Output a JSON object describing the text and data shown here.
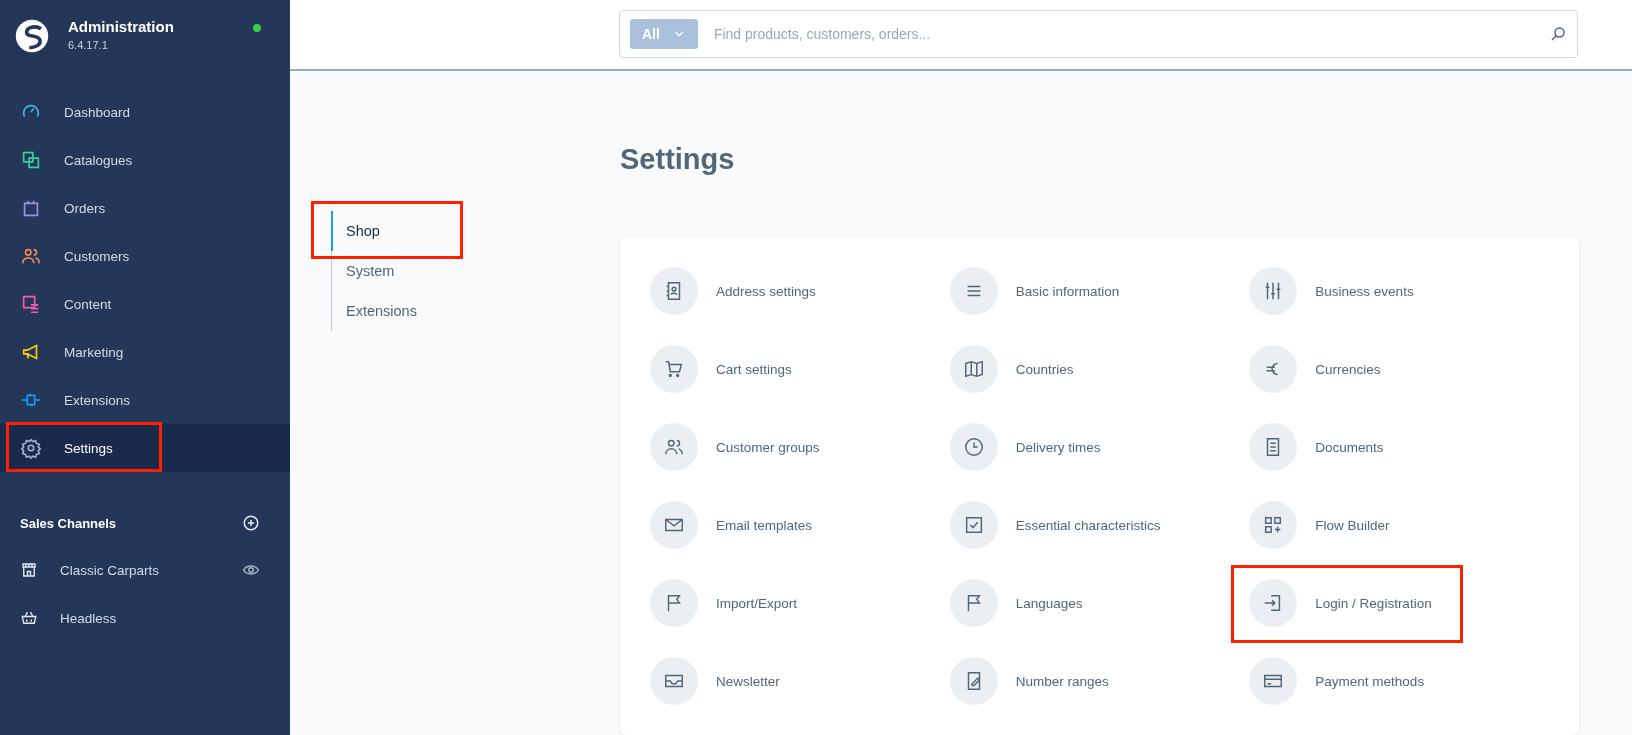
{
  "app": {
    "title": "Administration",
    "version": "6.4.17.1",
    "online": true
  },
  "nav": [
    {
      "label": "Dashboard",
      "color": "#3eb0e8",
      "selected": false,
      "highlighted": false
    },
    {
      "label": "Catalogues",
      "color": "#37d39b",
      "selected": false,
      "highlighted": false
    },
    {
      "label": "Orders",
      "color": "#9a8ee8",
      "selected": false,
      "highlighted": false
    },
    {
      "label": "Customers",
      "color": "#f08a5d",
      "selected": false,
      "highlighted": false
    },
    {
      "label": "Content",
      "color": "#ef5fa7",
      "selected": false,
      "highlighted": false
    },
    {
      "label": "Marketing",
      "color": "#ffd700",
      "selected": false,
      "highlighted": false
    },
    {
      "label": "Extensions",
      "color": "#189eff",
      "selected": false,
      "highlighted": false
    },
    {
      "label": "Settings",
      "color": "#a2b3c8",
      "selected": true,
      "highlighted": true
    }
  ],
  "sales_channels": {
    "title": "Sales Channels",
    "items": [
      {
        "label": "Classic Carparts",
        "visible_toggle": true
      },
      {
        "label": "Headless",
        "visible_toggle": false
      }
    ]
  },
  "search": {
    "scope": "All",
    "placeholder": "Find products, customers, orders..."
  },
  "page_title": "Settings",
  "tabs": [
    {
      "label": "Shop",
      "selected": true,
      "highlighted": true
    },
    {
      "label": "System",
      "selected": false,
      "highlighted": false
    },
    {
      "label": "Extensions",
      "selected": false,
      "highlighted": false
    }
  ],
  "settings": [
    {
      "label": "Address settings",
      "highlighted": false
    },
    {
      "label": "Basic information",
      "highlighted": false
    },
    {
      "label": "Business events",
      "highlighted": false
    },
    {
      "label": "Cart settings",
      "highlighted": false
    },
    {
      "label": "Countries",
      "highlighted": false
    },
    {
      "label": "Currencies",
      "highlighted": false
    },
    {
      "label": "Customer groups",
      "highlighted": false
    },
    {
      "label": "Delivery times",
      "highlighted": false
    },
    {
      "label": "Documents",
      "highlighted": false
    },
    {
      "label": "Email templates",
      "highlighted": false
    },
    {
      "label": "Essential characteristics",
      "highlighted": false
    },
    {
      "label": "Flow Builder",
      "highlighted": false
    },
    {
      "label": "Import/Export",
      "highlighted": false
    },
    {
      "label": "Languages",
      "highlighted": false
    },
    {
      "label": "Login / Registration",
      "highlighted": true
    },
    {
      "label": "Newsletter",
      "highlighted": false
    },
    {
      "label": "Number ranges",
      "highlighted": false
    },
    {
      "label": "Payment methods",
      "highlighted": false
    }
  ]
}
